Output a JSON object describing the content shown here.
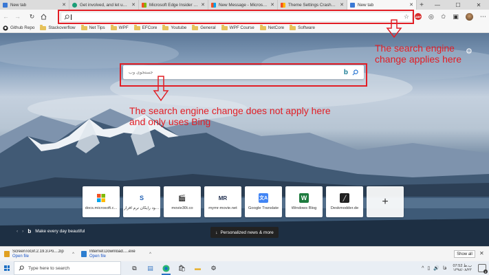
{
  "tabs": [
    {
      "label": "New tab",
      "icon_color": "#3a78d4",
      "active": false
    },
    {
      "label": "Get involved, and let us know",
      "icon_color": "#1b9e77",
      "active": false
    },
    {
      "label": "Microsoft Edge Insider - Mic",
      "icon_color": "#d04a2a",
      "active": false
    },
    {
      "label": "New Message - Microsoft Tec",
      "icon_color": "#e26b3b",
      "active": false
    },
    {
      "label": "Theme Settings Crashes - Mi",
      "icon_color": "#d04a2a",
      "active": false
    },
    {
      "label": "New tab",
      "icon_color": "#3a78d4",
      "active": true
    }
  ],
  "toolbar": {
    "address_value": "",
    "back_icon": "arrow-left-icon",
    "forward_icon": "arrow-right-icon",
    "refresh_icon": "refresh-icon",
    "home_icon": "home-icon"
  },
  "favorites": [
    {
      "label": "Github Repo",
      "type": "link"
    },
    {
      "label": "Stackoverflow",
      "type": "folder"
    },
    {
      "label": "Net Tips",
      "type": "folder"
    },
    {
      "label": "WPF",
      "type": "folder"
    },
    {
      "label": "EFCore",
      "type": "folder"
    },
    {
      "label": "Youtube",
      "type": "folder"
    },
    {
      "label": "General",
      "type": "folder"
    },
    {
      "label": "WPF Course",
      "type": "folder"
    },
    {
      "label": "NetCore",
      "type": "folder"
    },
    {
      "label": "Software",
      "type": "folder"
    }
  ],
  "search": {
    "placeholder": "جستجوی وب"
  },
  "annotations": {
    "top": "The search engine\nchange applies here",
    "middle": "The search engine change does not apply here\nand only uses Bing"
  },
  "tiles": [
    {
      "label": "docs.microsoft.c...",
      "icon": "windows-icon"
    },
    {
      "label": "دانلود رایگان نرم افزار",
      "icon": "s-icon"
    },
    {
      "label": "movie30t.co",
      "icon": "movie-icon"
    },
    {
      "label": "mymr-movie.net",
      "icon": "mr-icon"
    },
    {
      "label": "Google Translate",
      "icon": "translate-icon"
    },
    {
      "label": "Windows Blog",
      "icon": "w-icon"
    },
    {
      "label": "Deskmodder.de",
      "icon": "deskmodder-icon"
    }
  ],
  "background_caption": "Make every day beautiful",
  "news_button": "Personalized news & more",
  "downloads": [
    {
      "name": "ScreenToGif.2.19.3.Po....zip",
      "link": "Open file",
      "icon_color": "#e0a020"
    },
    {
      "name": "Internet.Download.....exe",
      "link": "Open file",
      "icon_color": "#2d7ed0"
    }
  ],
  "show_all": "Show all",
  "taskbar": {
    "search_placeholder": "Type here to search",
    "time": "07:52 ب.ظ",
    "date": "۱۳۹۸/۰۸/۲۳",
    "notification_count": "2"
  }
}
